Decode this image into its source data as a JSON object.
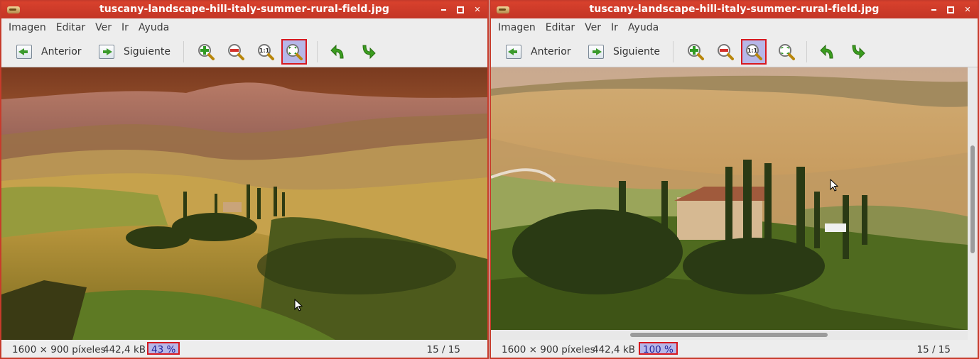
{
  "left": {
    "title": "tuscany-landscape-hill-italy-summer-rural-field.jpg",
    "menu": [
      "Imagen",
      "Editar",
      "Ver",
      "Ir",
      "Ayuda"
    ],
    "prev_label": "Anterior",
    "next_label": "Siguiente",
    "active_tool": "best-fit",
    "status": {
      "dims": "1600 × 900 píxeles",
      "size": "442,4 kB",
      "zoom": "43 %",
      "count": "15 / 15"
    }
  },
  "right": {
    "title": "tuscany-landscape-hill-italy-summer-rural-field.jpg",
    "menu": [
      "Imagen",
      "Editar",
      "Ver",
      "Ir",
      "Ayuda"
    ],
    "prev_label": "Anterior",
    "next_label": "Siguiente",
    "active_tool": "normal-size",
    "status": {
      "dims": "1600 × 900 píxeles",
      "size": "442,4 kB",
      "zoom": "100 %",
      "count": "15 / 15"
    }
  },
  "colors": {
    "titlebar": "#c73b2b",
    "active_tool_bg": "#b7b7e8",
    "highlight_border": "#d71920",
    "zoom_in_plus": "#2f9a23",
    "zoom_out_minus": "#d4312b",
    "rotate_arrows": "#3b9d1f"
  },
  "icons": [
    "app-icon",
    "prev-icon",
    "next-icon",
    "zoom-in-icon",
    "zoom-out-icon",
    "normal-size-icon",
    "best-fit-icon",
    "rotate-left-icon",
    "rotate-right-icon",
    "minimize-icon",
    "maximize-icon",
    "close-icon",
    "mouse-cursor-icon"
  ]
}
